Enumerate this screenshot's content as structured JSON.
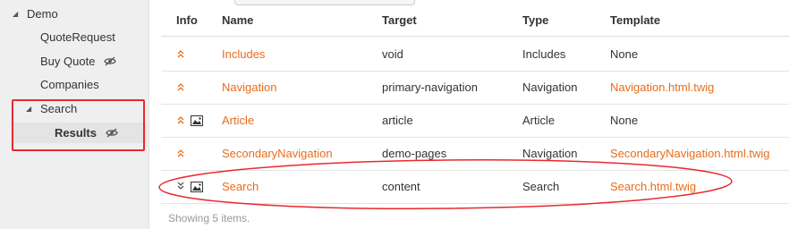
{
  "sidebar": {
    "items": [
      {
        "label": "Demo",
        "level": 0,
        "expanded": true
      },
      {
        "label": "QuoteRequest",
        "level": 1
      },
      {
        "label": "Buy Quote",
        "level": 1,
        "hidden_icon": "eye-slash-icon"
      },
      {
        "label": "Companies",
        "level": 1
      },
      {
        "label": "Search",
        "level": 1,
        "expanded": true
      },
      {
        "label": "Results",
        "level": 2,
        "selected": true,
        "hidden_icon": "eye-slash-icon"
      }
    ]
  },
  "grid": {
    "columns": [
      "Info",
      "Name",
      "Target",
      "Type",
      "Template"
    ],
    "rows": [
      {
        "name": "Includes",
        "target": "void",
        "type": "Includes",
        "template": "None",
        "template_link": false,
        "info_icons": [
          "chevron-up"
        ]
      },
      {
        "name": "Navigation",
        "target": "primary-navigation",
        "type": "Navigation",
        "template": "Navigation.html.twig",
        "template_link": true,
        "info_icons": [
          "chevron-up"
        ]
      },
      {
        "name": "Article",
        "target": "article",
        "type": "Article",
        "template": "None",
        "template_link": false,
        "info_icons": [
          "chevron-up",
          "image"
        ]
      },
      {
        "name": "SecondaryNavigation",
        "target": "demo-pages",
        "type": "Navigation",
        "template": "SecondaryNavigation.html.twig",
        "template_link": true,
        "info_icons": [
          "chevron-up"
        ]
      },
      {
        "name": "Search",
        "target": "content",
        "type": "Search",
        "template": "Search.html.twig",
        "template_link": true,
        "info_icons": [
          "chevron-down",
          "image"
        ]
      }
    ],
    "footer": "Showing 5 items."
  },
  "colors": {
    "link": "#e86c1a",
    "highlight": "#e8292f",
    "sidebar_bg": "#efefef"
  }
}
